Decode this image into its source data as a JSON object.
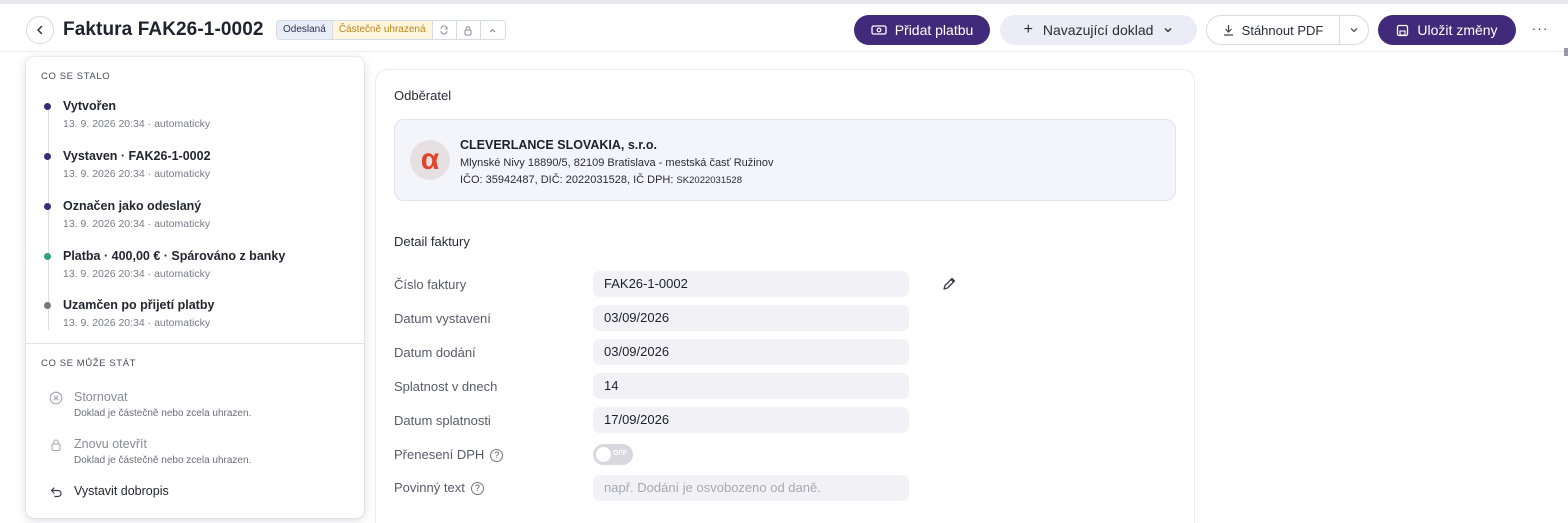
{
  "header": {
    "title": "Faktura FAK26-1-0002",
    "badge_sent": "Odeslaná",
    "badge_partial": "Částečně uhrazená",
    "add_payment": "Přidat platbu",
    "follow_doc": "Navazující doklad",
    "download_pdf": "Stáhnout PDF",
    "save": "Uložit změny",
    "more": "···"
  },
  "history": {
    "title": "Co se stalo",
    "events": [
      {
        "title": "Vytvořen",
        "sub": "13. 9. 2026 20:34 · automaticky",
        "color": "#3d2a74"
      },
      {
        "title": "Vystaven · FAK26-1-0002",
        "sub": "13. 9. 2026 20:34 · automaticky",
        "color": "#3d2a74"
      },
      {
        "title": "Označen jako odeslaný",
        "sub": "13. 9. 2026 20:34 · automaticky",
        "color": "#3d2a74"
      },
      {
        "title": "Platba · 400,00 € · Spárováno z banky",
        "sub": "13. 9. 2026 20:34 · automaticky",
        "color": "#2aa577"
      },
      {
        "title": "Uzamčen po přijetí platby",
        "sub": "13. 9. 2026 20:34 · automaticky",
        "color": "#777780"
      }
    ]
  },
  "actions": {
    "title": "Co se může stát",
    "items": [
      {
        "label": "Stornovat",
        "sub": "Doklad je částečně nebo zcela uhrazen.",
        "icon": "cancel-circle-icon"
      },
      {
        "label": "Znovu otevřít",
        "sub": "Doklad je částečně nebo zcela uhrazen.",
        "icon": "lock-icon"
      },
      {
        "label": "Vystavit dobropis",
        "sub": "",
        "icon": "undo-icon"
      }
    ]
  },
  "customer": {
    "section_title": "Odběratel",
    "name": "CLEVERLANCE SLOVAKIA, s.r.o.",
    "address": "Mlynské Nivy 18890/5, 82109 Bratislava - mestská časť Ružinov",
    "ids": "IČO: 35942487, DIČ: 2022031528, IČ DPH:",
    "vat_id": "SK2022031528",
    "logo_letter": "α"
  },
  "detail": {
    "section_title": "Detail faktury",
    "invoice_number_label": "Číslo faktury",
    "invoice_number": "FAK26-1-0002",
    "issue_date_label": "Datum vystavení",
    "issue_date": "03/09/2026",
    "delivery_date_label": "Datum dodání",
    "delivery_date": "03/09/2026",
    "due_days_label": "Splatnost v dnech",
    "due_days": "14",
    "due_date_label": "Datum splatnosti",
    "due_date": "17/09/2026",
    "reverse_charge_label": "Přenesení DPH",
    "reverse_charge_state": "OFF",
    "mandatory_text_label": "Povinný text",
    "mandatory_text_placeholder": "např. Dodání je osvobozeno od daně."
  }
}
